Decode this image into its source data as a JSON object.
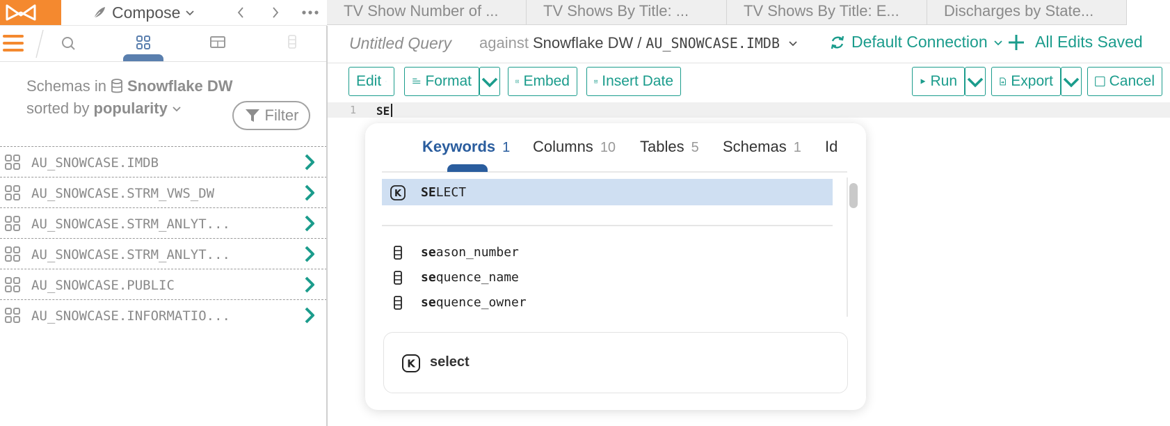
{
  "app": {
    "compose_label": "Compose",
    "colors": {
      "accent": "#1b9c8c",
      "brand": "#f4892f",
      "active_blue": "#2a5d9e",
      "selected_row": "#cfdff2"
    }
  },
  "doc_tabs": [
    {
      "label": "TV Show Number of ..."
    },
    {
      "label": "TV Shows By Title: ..."
    },
    {
      "label": "TV Shows By Title: E..."
    },
    {
      "label": "Discharges by State..."
    }
  ],
  "sidebar": {
    "schemas_prefix": "Schemas in",
    "warehouse": "Snowflake DW",
    "sorted_by_prefix": "sorted by",
    "sort_value": "popularity",
    "filter_label": "Filter",
    "schemas": [
      {
        "name": "AU_SNOWCASE.IMDB"
      },
      {
        "name": "AU_SNOWCASE.STRM_VWS_DW"
      },
      {
        "name": "AU_SNOWCASE.STRM_ANLYT..."
      },
      {
        "name": "AU_SNOWCASE.STRM_ANLYT..."
      },
      {
        "name": "AU_SNOWCASE.PUBLIC"
      },
      {
        "name": "AU_SNOWCASE.INFORMATIO..."
      }
    ]
  },
  "query": {
    "title": "Untitled Query",
    "against_label": "against",
    "connection": "Snowflake DW",
    "separator": "/",
    "schema": "AU_SNOWCASE.IMDB",
    "default_connection": "Default Connection",
    "save_status": "All Edits Saved"
  },
  "toolbar": {
    "edit": "Edit",
    "format": "Format",
    "embed": "Embed",
    "insert_date": "Insert Date",
    "run": "Run",
    "export": "Export",
    "cancel": "Cancel"
  },
  "editor": {
    "line_number": "1",
    "text": "SE"
  },
  "autocomplete": {
    "tabs": [
      {
        "label": "Keywords",
        "count": "1"
      },
      {
        "label": "Columns",
        "count": "10"
      },
      {
        "label": "Tables",
        "count": "5"
      },
      {
        "label": "Schemas",
        "count": "1"
      },
      {
        "label": "Id",
        "count": ""
      }
    ],
    "keyword_item": {
      "match": "SE",
      "rest": "LECT"
    },
    "column_items": [
      {
        "match": "se",
        "rest": "ason_number"
      },
      {
        "match": "se",
        "rest": "quence_name"
      },
      {
        "match": "se",
        "rest": "quence_owner"
      }
    ],
    "detail_label": "select"
  }
}
